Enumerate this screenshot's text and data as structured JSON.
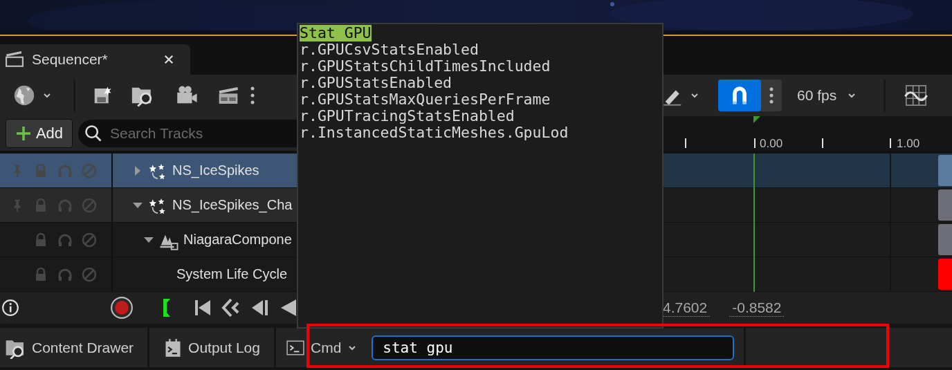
{
  "tab": {
    "title": "Sequencer*"
  },
  "toolbar": {
    "snap_on": true,
    "frame_rate": "60 fps"
  },
  "add_button": "Add",
  "search": {
    "placeholder": "Search Tracks"
  },
  "ruler": {
    "labels": [
      "0.00",
      "1.00"
    ]
  },
  "tracks": [
    {
      "name": "NS_IceSpikes",
      "selected": true,
      "expanded": false,
      "color": "#5a7a9e",
      "kind": "system"
    },
    {
      "name": "NS_IceSpikes_Cha",
      "selected": false,
      "expanded": true,
      "color": "#6e6e78",
      "kind": "system",
      "children": [
        {
          "name": "NiagaraCompone",
          "selected": false,
          "expanded": true,
          "color": "#6e6e78",
          "kind": "component",
          "children": [
            {
              "name": "System Life Cycle",
              "selected": false,
              "color": "#ff0000",
              "kind": "lifecycle"
            }
          ]
        }
      ]
    }
  ],
  "transport": {
    "values": [
      "4.7602",
      "-0.8582"
    ]
  },
  "bottom_bar": {
    "tabs": [
      "Content Drawer",
      "Output Log"
    ],
    "cmd": {
      "label": "Cmd",
      "value": "stat gpu"
    }
  },
  "console_suggestions": [
    {
      "text": "Stat GPU",
      "selected": true
    },
    {
      "text": "r.GPUCsvStatsEnabled",
      "selected": false
    },
    {
      "text": "r.GPUStatsChildTimesIncluded",
      "selected": false
    },
    {
      "text": "r.GPUStatsEnabled",
      "selected": false
    },
    {
      "text": "r.GPUStatsMaxQueriesPerFrame",
      "selected": false
    },
    {
      "text": "r.GPUTracingStatsEnabled",
      "selected": false
    },
    {
      "text": "r.InstancedStaticMeshes.GpuLod",
      "selected": false
    }
  ]
}
